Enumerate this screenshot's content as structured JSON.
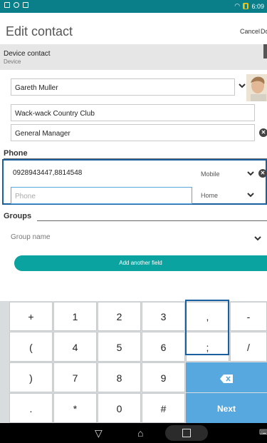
{
  "status": {
    "time": "6:09"
  },
  "appbar": {
    "title": "Edit contact",
    "cancel": "Cancel",
    "done": "Do"
  },
  "account": {
    "name": "Device contact",
    "type": "Device"
  },
  "fields": {
    "name": "Gareth Muller",
    "company": "Wack-wack Country Club",
    "title": "General Manager"
  },
  "phone": {
    "section": "Phone",
    "rows": [
      {
        "value": "0928943447,8814548",
        "placeholder": "",
        "type": "Mobile"
      },
      {
        "value": "",
        "placeholder": "Phone",
        "type": "Home"
      }
    ]
  },
  "groups": {
    "section": "Groups",
    "placeholder": "Group name"
  },
  "add_field": "Add another field",
  "keyboard": {
    "rows": [
      [
        "+",
        "1",
        "2",
        "3",
        ",",
        "-"
      ],
      [
        "(",
        "4",
        "5",
        "6",
        ";",
        "/"
      ],
      [
        ")",
        "7",
        "8",
        "9",
        "⌫"
      ],
      [
        ".",
        "*",
        "0",
        "#",
        "Next"
      ]
    ]
  },
  "colors": {
    "accent": "#0aa3a0",
    "status": "#0a7f8a",
    "key_blue": "#57a8de",
    "highlight": "#1a5fa0"
  },
  "icons": [
    "photo-icon",
    "alarm-icon",
    "wifi-icon",
    "battery-icon",
    "chevron-down-icon",
    "remove-icon",
    "back-icon",
    "home-icon",
    "recent-apps-icon",
    "backspace-icon"
  ]
}
